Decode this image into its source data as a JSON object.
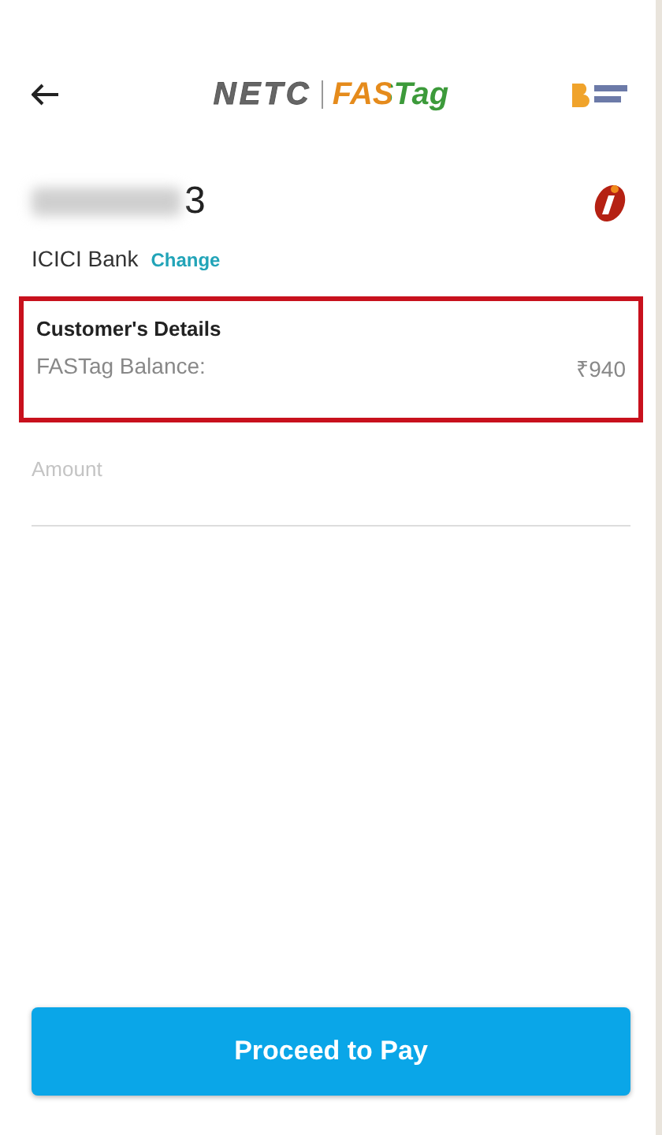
{
  "header": {
    "logo_left": "NETC",
    "logo_right": "FASTag"
  },
  "vehicle": {
    "number_visible": "3",
    "blurred": true
  },
  "bank": {
    "name": "ICICI Bank",
    "change": "Change"
  },
  "details": {
    "title": "Customer's Details",
    "highlighted": true,
    "label": "FASTag Balance:",
    "value": "₹940"
  },
  "amount": {
    "placeholder": "Amount"
  },
  "button": {
    "label": "Proceed to Pay"
  }
}
